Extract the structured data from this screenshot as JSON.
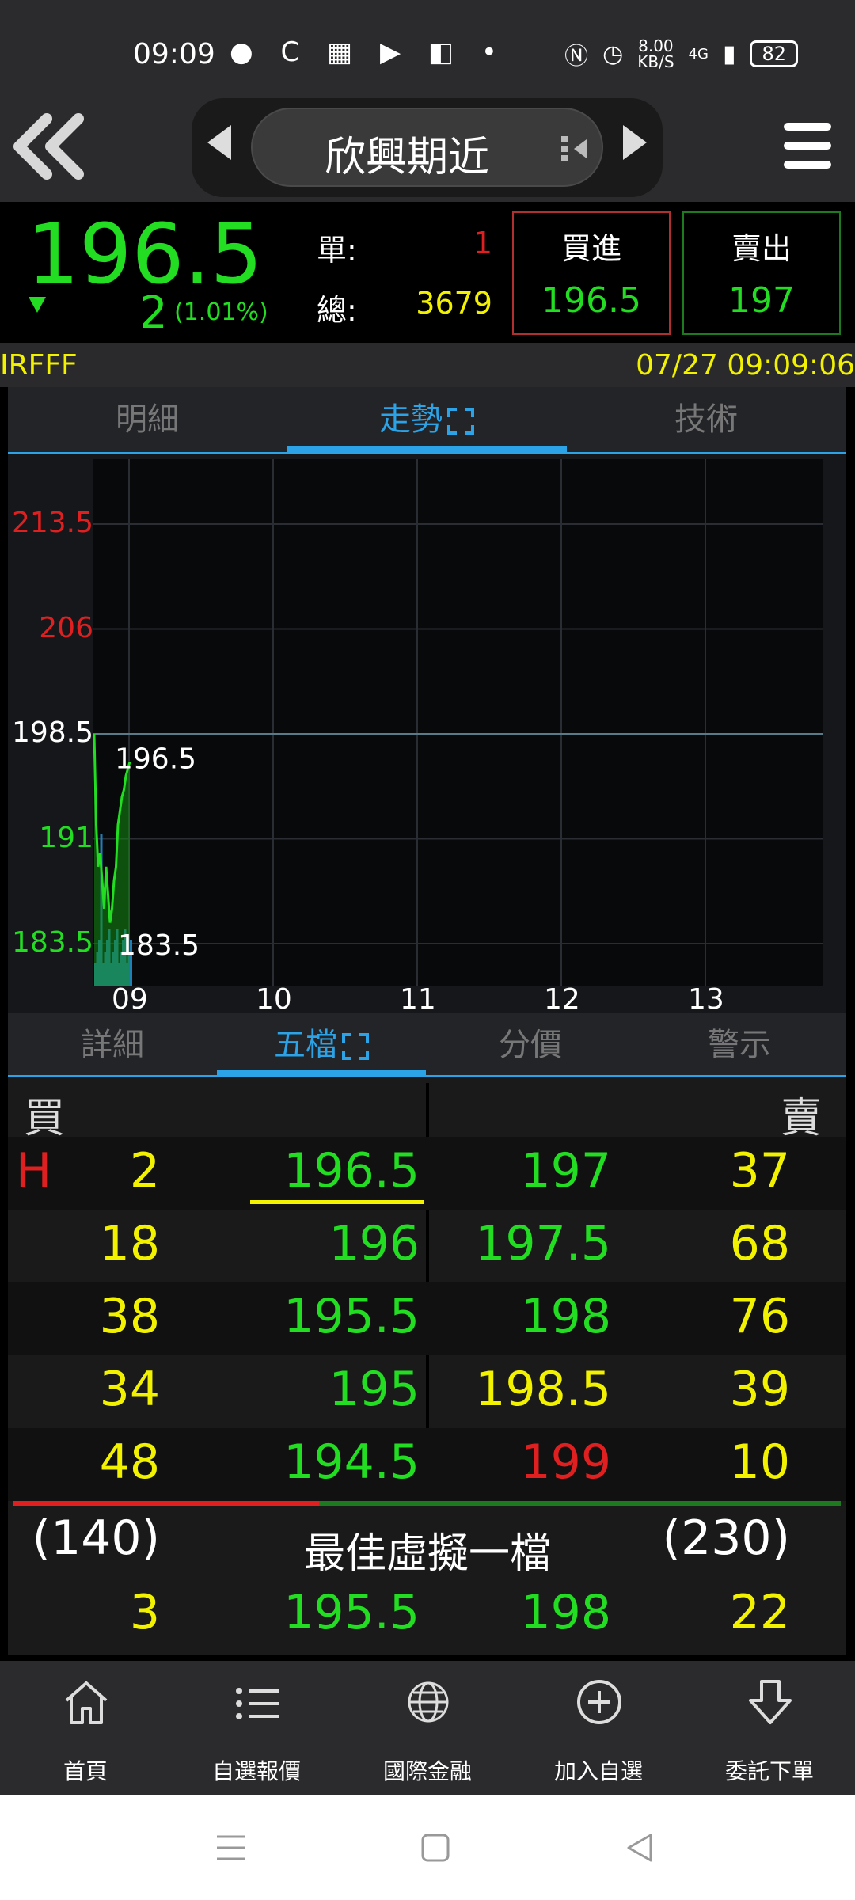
{
  "status_bar": {
    "time": "09:09",
    "net_speed": "8.00",
    "net_unit": "KB/S",
    "network": "4G",
    "battery": "82"
  },
  "nav": {
    "title": "欣興期近"
  },
  "quote": {
    "price": "196.5",
    "change": "2",
    "change_pct": "(1.01%)",
    "single_label": "單:",
    "single_value": "1",
    "total_label": "總:",
    "total_value": "3679",
    "buy_label": "買進",
    "buy_price": "196.5",
    "sell_label": "賣出",
    "sell_price": "197",
    "symbol": "IRFFF",
    "datetime": "07/27 09:09:06"
  },
  "top_tabs": [
    {
      "label": "明細",
      "active": false
    },
    {
      "label": "走勢",
      "active": true
    },
    {
      "label": "技術",
      "active": false
    }
  ],
  "chart_data": {
    "type": "area",
    "ylim": [
      183.5,
      213.5
    ],
    "y_ticks": [
      {
        "label": "213.5",
        "color": "#e02020"
      },
      {
        "label": "206",
        "color": "#e02020"
      },
      {
        "label": "198.5",
        "color": "#ffffff"
      },
      {
        "label": "191",
        "color": "#22dd22"
      },
      {
        "label": "183.5",
        "color": "#22dd22"
      }
    ],
    "reference": 198.5,
    "x_ticks": [
      "09",
      "10",
      "11",
      "12",
      "13"
    ],
    "annotations": {
      "high": "196.5",
      "low": "183.5"
    },
    "series": [
      {
        "x": [
          0,
          0.5,
          1,
          1.5,
          2,
          2.5,
          3,
          3.5,
          4,
          4.5,
          5,
          5.5,
          6,
          6.5,
          7,
          7.5,
          8,
          8.5,
          9
        ],
        "values": [
          198.5,
          192,
          189,
          190,
          188,
          186,
          189,
          187,
          185,
          186,
          188,
          189,
          192,
          193,
          194,
          194.5,
          195.5,
          196,
          196.5
        ]
      }
    ]
  },
  "bottom_tabs": [
    {
      "label": "詳細",
      "active": false
    },
    {
      "label": "五檔",
      "active": true
    },
    {
      "label": "分價",
      "active": false
    },
    {
      "label": "警示",
      "active": false
    }
  ],
  "order_book": {
    "buy_header": "買",
    "sell_header": "賣",
    "high_marker": "H",
    "rows": [
      {
        "bid_qty": "2",
        "bid_price": "196.5",
        "ask_price": "197",
        "ask_qty": "37"
      },
      {
        "bid_qty": "18",
        "bid_price": "196",
        "ask_price": "197.5",
        "ask_qty": "68"
      },
      {
        "bid_qty": "38",
        "bid_price": "195.5",
        "ask_price": "198",
        "ask_qty": "76"
      },
      {
        "bid_qty": "34",
        "bid_price": "195",
        "ask_price": "198.5",
        "ask_qty": "39"
      },
      {
        "bid_qty": "48",
        "bid_price": "194.5",
        "ask_price": "199",
        "ask_qty": "10"
      }
    ],
    "bid_total": "(140)",
    "ask_total": "(230)",
    "virtual_label": "最佳虛擬一檔",
    "virtual": {
      "bid_qty": "3",
      "bid_price": "195.5",
      "ask_price": "198",
      "ask_qty": "22"
    },
    "bid_ratio": 0.37
  },
  "bottom_nav": [
    {
      "label": "首頁",
      "icon": "home-icon"
    },
    {
      "label": "自選報價",
      "icon": "watchlist-icon"
    },
    {
      "label": "國際金融",
      "icon": "globe-icon"
    },
    {
      "label": "加入自選",
      "icon": "add-circle-icon"
    },
    {
      "label": "委託下單",
      "icon": "order-icon"
    }
  ]
}
